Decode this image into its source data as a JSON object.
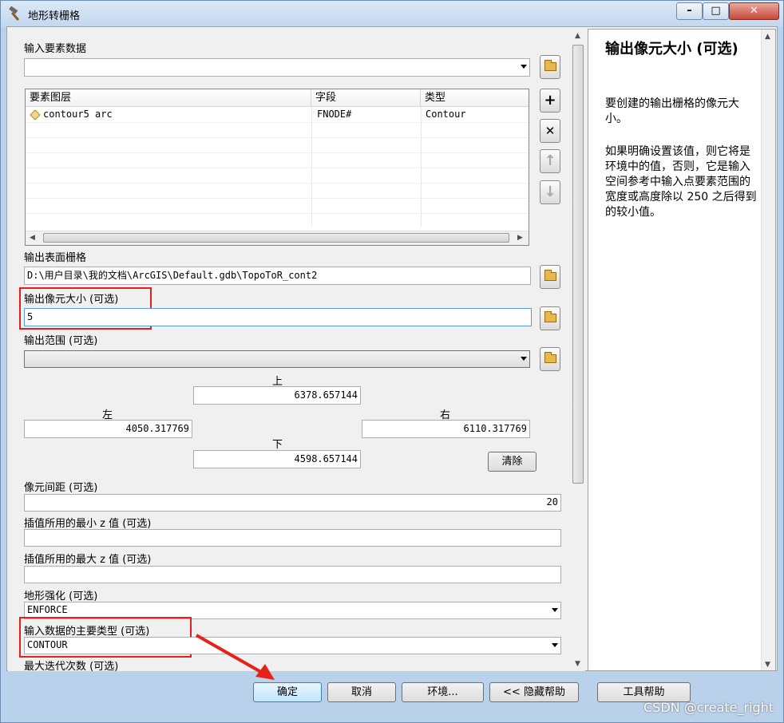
{
  "window": {
    "title": "地形转栅格"
  },
  "form": {
    "input_features_label": "输入要素数据",
    "input_features_value": "",
    "table_headers": [
      "要素图层",
      "字段",
      "类型"
    ],
    "table_rows": [
      {
        "layer": "contour5 arc",
        "field": "FNODE#",
        "type": "Contour"
      }
    ],
    "output_surface_label": "输出表面栅格",
    "output_surface_value": "D:\\用户目录\\我的文档\\ArcGIS\\Default.gdb\\TopoToR_cont2",
    "cell_size_label": "输出像元大小 (可选)",
    "cell_size_value": "5",
    "extent_label": "输出范围 (可选)",
    "extent_value": "",
    "extent_top_label": "上",
    "extent_top": "6378.657144",
    "extent_left_label": "左",
    "extent_left": "4050.317769",
    "extent_right_label": "右",
    "extent_right": "6110.317769",
    "extent_bottom_label": "下",
    "extent_bottom": "4598.657144",
    "clear_label": "清除",
    "margin_label": "像元间距 (可选)",
    "margin_value": "20",
    "min_z_label": "插值所用的最小 z 值 (可选)",
    "min_z_value": "",
    "max_z_label": "插值所用的最大 z 值 (可选)",
    "max_z_value": "",
    "enforce_label": "地形强化 (可选)",
    "enforce_value": "ENFORCE",
    "data_type_label": "输入数据的主要类型 (可选)",
    "data_type_value": "CONTOUR",
    "iterations_label": "最大迭代次数 (可选)"
  },
  "buttons": {
    "ok": "确定",
    "cancel": "取消",
    "env": "环境...",
    "hide_help": "<< 隐藏帮助",
    "tool_help": "工具帮助"
  },
  "help": {
    "title": "输出像元大小 (可选)",
    "p1": "要创建的输出栅格的像元大小。",
    "p2": "如果明确设置该值，则它将是环境中的值，否则，它是输入空间参考中输入点要素范围的宽度或高度除以 250 之后得到的较小值。"
  },
  "watermark": "CSDN @create_right"
}
